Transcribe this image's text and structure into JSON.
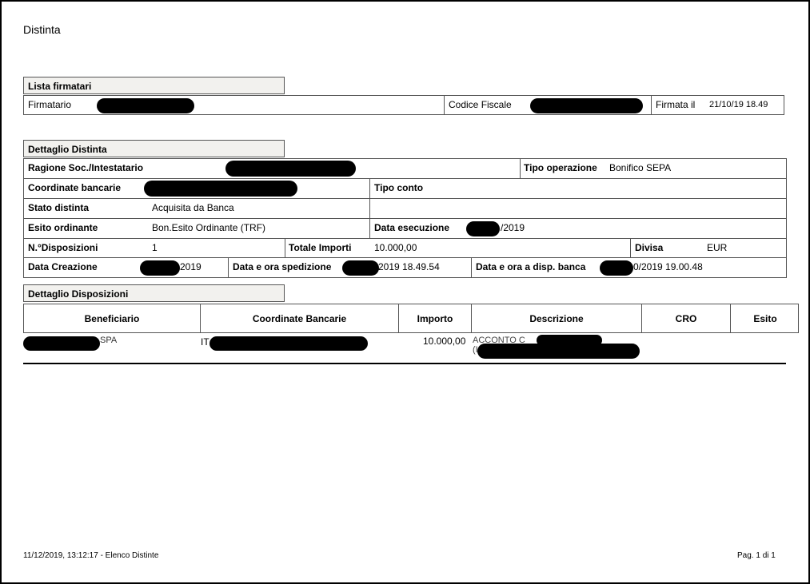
{
  "title": "Distinta",
  "lista_firmatari": {
    "header": "Lista firmatari",
    "firmatario_label": "Firmatario",
    "codice_fiscale_label": "Codice Fiscale",
    "firmata_il_label": "Firmata il",
    "firmata_il_value": "21/10/19 18.49"
  },
  "dettaglio_distinta": {
    "header": "Dettaglio Distinta",
    "ragione_label": "Ragione Soc./Intestatario",
    "tipo_operazione_label": "Tipo operazione",
    "tipo_operazione_value": "Bonifico SEPA",
    "coordinate_label": "Coordinate bancarie",
    "tipo_conto_label": "Tipo conto",
    "stato_label": "Stato distinta",
    "stato_value": "Acquisita da Banca",
    "esito_label": "Esito ordinante",
    "esito_value": "Bon.Esito Ordinante (TRF)",
    "data_esecuzione_label": "Data esecuzione",
    "data_esecuzione_value": "/2019",
    "n_disposizioni_label": "N.°Disposizioni",
    "n_disposizioni_value": "1",
    "totale_label": "Totale Importi",
    "totale_value": "10.000,00",
    "divisa_label": "Divisa",
    "divisa_value": "EUR",
    "data_creazione_label": "Data Creazione",
    "data_creazione_value": "2019",
    "spedizione_label": "Data e ora spedizione",
    "spedizione_value": "2019 18.49.54",
    "disp_banca_label": "Data e ora a disp. banca",
    "disp_banca_value": "0/2019 19.00.48"
  },
  "dettaglio_disposizioni": {
    "header": "Dettaglio Disposizioni",
    "columns": [
      "Beneficiario",
      "Coordinate Bancarie",
      "Importo",
      "Descrizione",
      "CRO",
      "Esito"
    ],
    "row": {
      "beneficiario": "SPA",
      "coordinate": "IT",
      "importo": "10.000,00",
      "descrizione_1": "ACCONTO C",
      "descrizione_2": "(I"
    }
  },
  "footer": {
    "left": "11/12/2019, 13:12:17 - Elenco Distinte",
    "right": "Pag. 1 di 1"
  }
}
